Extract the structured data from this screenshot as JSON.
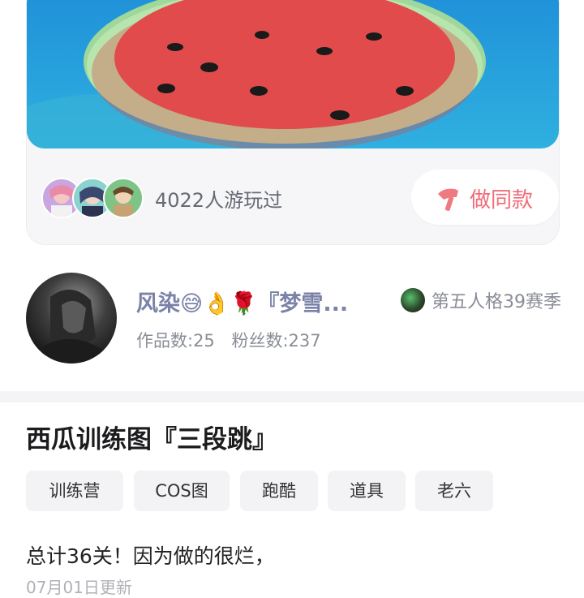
{
  "card": {
    "played_count_text": "4022人游玩过",
    "same_button_label": "做同款",
    "player_avatars": [
      "player-avatar-1",
      "player-avatar-2",
      "player-avatar-3"
    ],
    "banner_icon": "watermelon-illustration"
  },
  "author": {
    "name": "风染",
    "name_emojis": "😅👌🌹",
    "name_suffix": "『梦雪...",
    "season_label": "第五人格39赛季",
    "works": "作品数:25",
    "fans": "粉丝数:237"
  },
  "post": {
    "title": "西瓜训练图『三段跳』",
    "tags": [
      "训练营",
      "COS图",
      "跑酷",
      "道具",
      "老六"
    ],
    "description": "总计36关！因为做的很烂，",
    "update_text": "07月01日更新"
  },
  "colors": {
    "accent": "#f06b78",
    "author_name": "#7a82a8",
    "sky": "#1a9ad6"
  }
}
